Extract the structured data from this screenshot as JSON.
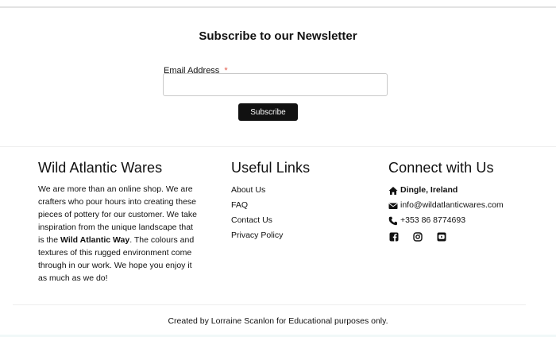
{
  "newsletter": {
    "title": "Subscribe to our Newsletter",
    "email_label": "Email Address",
    "required_marker": "*",
    "email_value": "",
    "email_placeholder": "",
    "subscribe_label": "Subscribe"
  },
  "about": {
    "heading": "Wild Atlantic Wares",
    "text_before": "We are more than an online shop. We are crafters who pour hours into creating these pieces of pottery for our customer. We take inspiration from the unique landscape that is the ",
    "text_bold": "Wild Atlantic Way",
    "text_after": ". The colours and textures of this rugged environment come through in our work. We hope you enjoy it as much as we do!"
  },
  "links": {
    "heading": "Useful Links",
    "items": [
      "About Us",
      "FAQ",
      "Contact Us",
      "Privacy Policy"
    ]
  },
  "connect": {
    "heading": "Connect with Us",
    "location": "Dingle, Ireland",
    "email": "info@wildatlanticwares.com",
    "phone": "+353 86 8774693",
    "social_icons": [
      "facebook-icon",
      "instagram-icon",
      "youtube-icon"
    ]
  },
  "footer": {
    "credit": "Created by Lorraine Scanlon for Educational purposes only."
  },
  "colors": {
    "required": "#e25a4a",
    "button_bg": "#111111"
  }
}
